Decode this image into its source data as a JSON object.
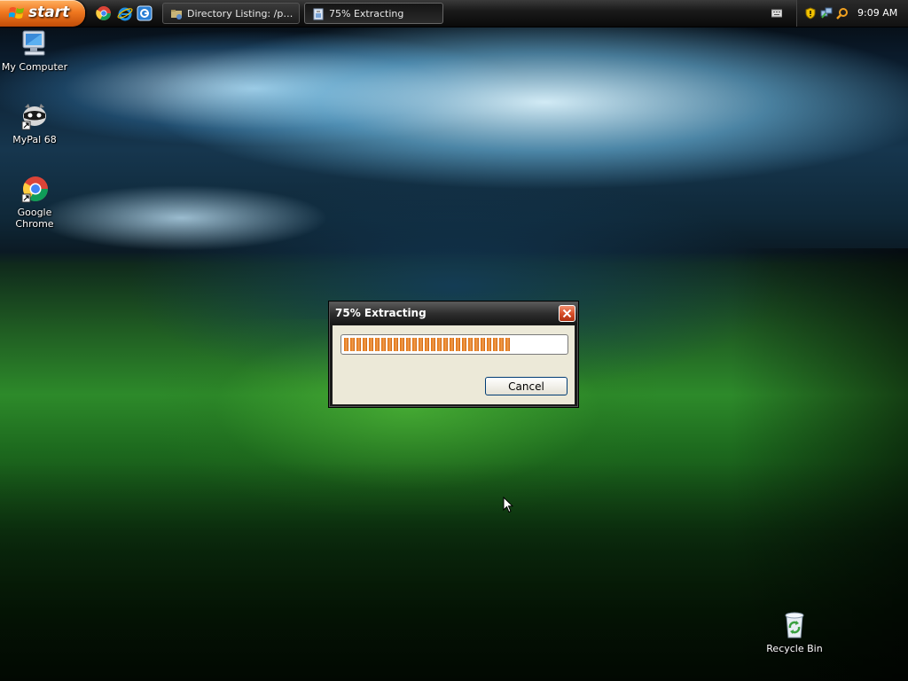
{
  "taskbar": {
    "start_label": "start",
    "quick_launch": [
      {
        "icon": "chrome-icon"
      },
      {
        "icon": "internet-explorer-icon"
      },
      {
        "icon": "show-desktop-icon"
      }
    ],
    "tasks": [
      {
        "label": "Directory Listing: /pu...",
        "icon": "folder-network-icon",
        "active": false
      },
      {
        "label": "75% Extracting",
        "icon": "extract-icon",
        "active": true
      }
    ],
    "tray": {
      "icons": [
        "keyboard-icon",
        "security-shield-icon",
        "network-icon",
        "search-icon"
      ],
      "clock": "9:09 AM"
    }
  },
  "desktop_icons": [
    {
      "label": "My Computer",
      "icon": "my-computer-icon"
    },
    {
      "label": "MyPal 68",
      "icon": "mypal-icon"
    },
    {
      "label": "Google Chrome",
      "icon": "chrome-icon"
    },
    {
      "label": "Recycle Bin",
      "icon": "recycle-bin-icon"
    }
  ],
  "dialog": {
    "title": "75% Extracting",
    "progress": 0.75,
    "cancel_label": "Cancel"
  },
  "colors": {
    "start_orange": "#f07820",
    "progress_orange": "#e07010",
    "dialog_face": "#ece9d8",
    "close_red": "#d8502a"
  }
}
